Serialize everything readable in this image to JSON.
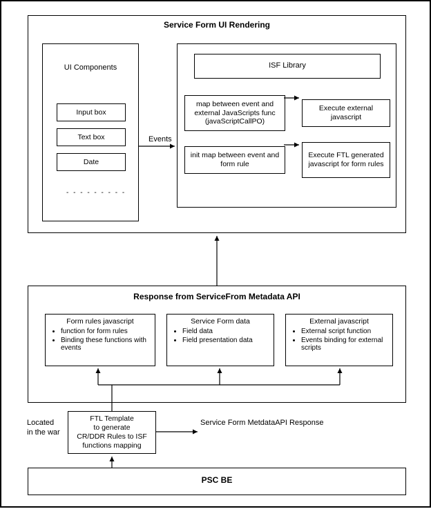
{
  "top_box": {
    "title": "Service Form UI Rendering",
    "ui_components": {
      "title": "UI Components",
      "items": [
        "Input box",
        "Text box",
        "Date"
      ],
      "ellipsis": "- - - - - - - - -"
    },
    "events_label": "Events",
    "right_box": {
      "isf_library": "ISF Library",
      "map_event_external": "map between event and external JavaScripts func (javaScriptCallPO)",
      "execute_external": "Execute external javascript",
      "init_map_form_rule": "init map between event and form rule",
      "execute_ftl": "Execute FTL generated javascript for form rules"
    }
  },
  "mid_box": {
    "title": "Response from ServiceFrom Metadata API",
    "form_rules": {
      "title": "Form rules javascript",
      "bullets": [
        "function for form rules",
        "Binding these functions with events"
      ]
    },
    "service_form_data": {
      "title": "Service Form data",
      "bullets": [
        "Field data",
        "Field presentation data"
      ]
    },
    "external_js": {
      "title": "External javascript",
      "bullets": [
        "External script function",
        "Events binding for external scripts"
      ]
    }
  },
  "ftl_template": {
    "text": "FTL Template\nto generate\nCR/DDR Rules to ISF\nfunctions mapping"
  },
  "located_label": "Located\nin the war",
  "metadata_response_label": "Service Form MetdataAPI  Response",
  "psc_be": "PSC BE",
  "chart_data": {
    "type": "diagram",
    "title": "Service Form UI Rendering Architecture",
    "nodes": [
      {
        "id": "top",
        "label": "Service Form UI Rendering",
        "children": [
          "ui_components",
          "right_panel"
        ]
      },
      {
        "id": "ui_components",
        "label": "UI Components",
        "children": [
          "input_box",
          "text_box",
          "date"
        ]
      },
      {
        "id": "input_box",
        "label": "Input box"
      },
      {
        "id": "text_box",
        "label": "Text box"
      },
      {
        "id": "date",
        "label": "Date"
      },
      {
        "id": "right_panel",
        "children": [
          "isf_library",
          "map_ext",
          "exec_ext",
          "init_map",
          "exec_ftl"
        ]
      },
      {
        "id": "isf_library",
        "label": "ISF Library"
      },
      {
        "id": "map_ext",
        "label": "map between event and external JavaScripts func (javaScriptCallPO)"
      },
      {
        "id": "exec_ext",
        "label": "Execute external javascript"
      },
      {
        "id": "init_map",
        "label": "init map between event and form rule"
      },
      {
        "id": "exec_ftl",
        "label": "Execute FTL generated javascript for form rules"
      },
      {
        "id": "mid",
        "label": "Response from ServiceFrom Metadata API",
        "children": [
          "form_rules",
          "sf_data",
          "ext_js"
        ]
      },
      {
        "id": "form_rules",
        "label": "Form rules javascript"
      },
      {
        "id": "sf_data",
        "label": "Service Form data"
      },
      {
        "id": "ext_js",
        "label": "External javascript"
      },
      {
        "id": "ftl",
        "label": "FTL Template to generate CR/DDR Rules to ISF functions mapping"
      },
      {
        "id": "psc_be",
        "label": "PSC BE"
      }
    ],
    "edges": [
      {
        "from": "ui_components",
        "to": "right_panel",
        "label": "Events"
      },
      {
        "from": "map_ext",
        "to": "exec_ext"
      },
      {
        "from": "init_map",
        "to": "exec_ftl"
      },
      {
        "from": "mid",
        "to": "top"
      },
      {
        "from": "ftl",
        "to": "form_rules"
      },
      {
        "from": "ftl",
        "to": "sf_data",
        "label": "Service Form MetdataAPI Response"
      },
      {
        "from": "ftl",
        "to": "ext_js"
      },
      {
        "from": "psc_be",
        "to": "ftl"
      }
    ]
  }
}
